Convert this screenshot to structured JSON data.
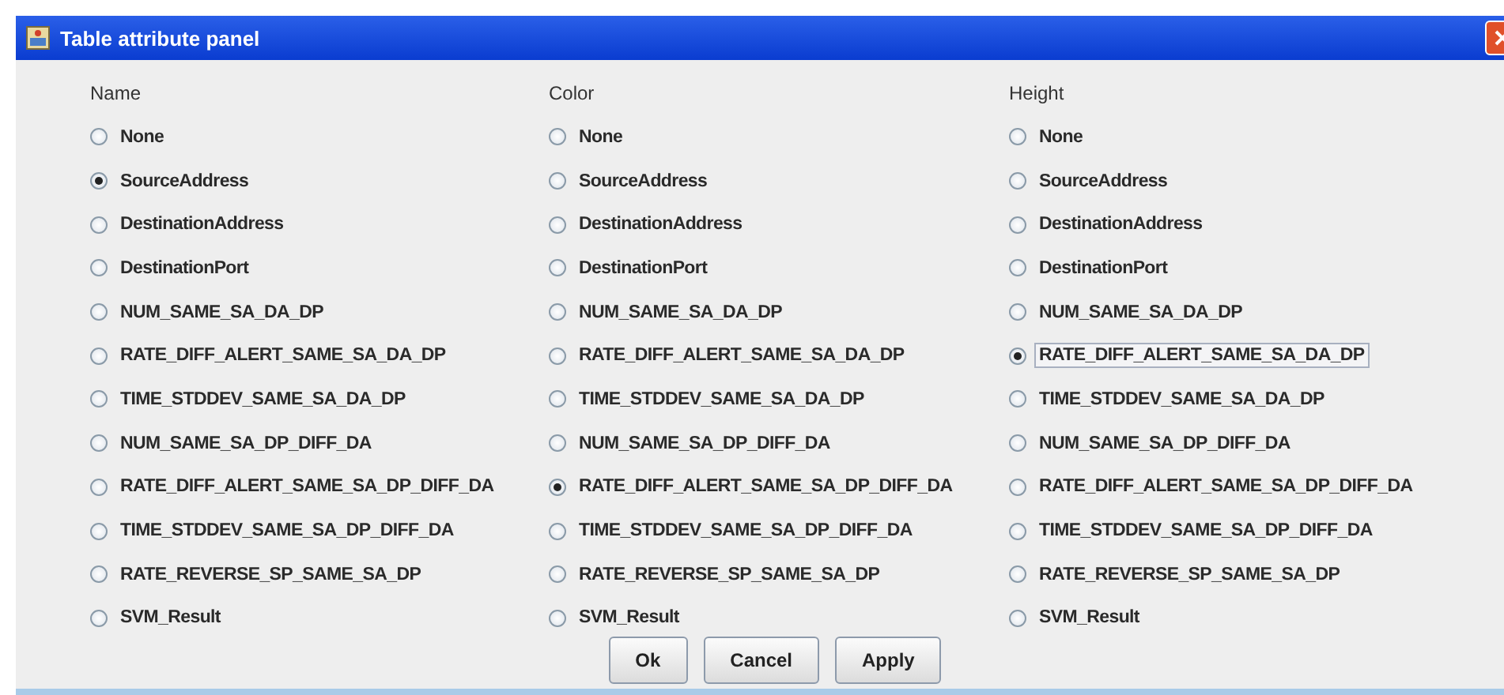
{
  "window": {
    "title": "Table attribute panel"
  },
  "columns": [
    {
      "heading": "Name",
      "options": [
        {
          "label": "None",
          "selected": false,
          "focused": false
        },
        {
          "label": "SourceAddress",
          "selected": true,
          "focused": false
        },
        {
          "label": "DestinationAddress",
          "selected": false,
          "focused": false
        },
        {
          "label": "DestinationPort",
          "selected": false,
          "focused": false
        },
        {
          "label": "NUM_SAME_SA_DA_DP",
          "selected": false,
          "focused": false
        },
        {
          "label": "RATE_DIFF_ALERT_SAME_SA_DA_DP",
          "selected": false,
          "focused": false
        },
        {
          "label": "TIME_STDDEV_SAME_SA_DA_DP",
          "selected": false,
          "focused": false
        },
        {
          "label": "NUM_SAME_SA_DP_DIFF_DA",
          "selected": false,
          "focused": false
        },
        {
          "label": "RATE_DIFF_ALERT_SAME_SA_DP_DIFF_DA",
          "selected": false,
          "focused": false
        },
        {
          "label": "TIME_STDDEV_SAME_SA_DP_DIFF_DA",
          "selected": false,
          "focused": false
        },
        {
          "label": "RATE_REVERSE_SP_SAME_SA_DP",
          "selected": false,
          "focused": false
        },
        {
          "label": "SVM_Result",
          "selected": false,
          "focused": false
        }
      ]
    },
    {
      "heading": "Color",
      "options": [
        {
          "label": "None",
          "selected": false,
          "focused": false
        },
        {
          "label": "SourceAddress",
          "selected": false,
          "focused": false
        },
        {
          "label": "DestinationAddress",
          "selected": false,
          "focused": false
        },
        {
          "label": "DestinationPort",
          "selected": false,
          "focused": false
        },
        {
          "label": "NUM_SAME_SA_DA_DP",
          "selected": false,
          "focused": false
        },
        {
          "label": "RATE_DIFF_ALERT_SAME_SA_DA_DP",
          "selected": false,
          "focused": false
        },
        {
          "label": "TIME_STDDEV_SAME_SA_DA_DP",
          "selected": false,
          "focused": false
        },
        {
          "label": "NUM_SAME_SA_DP_DIFF_DA",
          "selected": false,
          "focused": false
        },
        {
          "label": "RATE_DIFF_ALERT_SAME_SA_DP_DIFF_DA",
          "selected": true,
          "focused": false
        },
        {
          "label": "TIME_STDDEV_SAME_SA_DP_DIFF_DA",
          "selected": false,
          "focused": false
        },
        {
          "label": "RATE_REVERSE_SP_SAME_SA_DP",
          "selected": false,
          "focused": false
        },
        {
          "label": "SVM_Result",
          "selected": false,
          "focused": false
        }
      ]
    },
    {
      "heading": "Height",
      "options": [
        {
          "label": "None",
          "selected": false,
          "focused": false
        },
        {
          "label": "SourceAddress",
          "selected": false,
          "focused": false
        },
        {
          "label": "DestinationAddress",
          "selected": false,
          "focused": false
        },
        {
          "label": "DestinationPort",
          "selected": false,
          "focused": false
        },
        {
          "label": "NUM_SAME_SA_DA_DP",
          "selected": false,
          "focused": false
        },
        {
          "label": "RATE_DIFF_ALERT_SAME_SA_DA_DP",
          "selected": true,
          "focused": true
        },
        {
          "label": "TIME_STDDEV_SAME_SA_DA_DP",
          "selected": false,
          "focused": false
        },
        {
          "label": "NUM_SAME_SA_DP_DIFF_DA",
          "selected": false,
          "focused": false
        },
        {
          "label": "RATE_DIFF_ALERT_SAME_SA_DP_DIFF_DA",
          "selected": false,
          "focused": false
        },
        {
          "label": "TIME_STDDEV_SAME_SA_DP_DIFF_DA",
          "selected": false,
          "focused": false
        },
        {
          "label": "RATE_REVERSE_SP_SAME_SA_DP",
          "selected": false,
          "focused": false
        },
        {
          "label": "SVM_Result",
          "selected": false,
          "focused": false
        }
      ]
    }
  ],
  "buttons": [
    "Ok",
    "Cancel",
    "Apply"
  ]
}
